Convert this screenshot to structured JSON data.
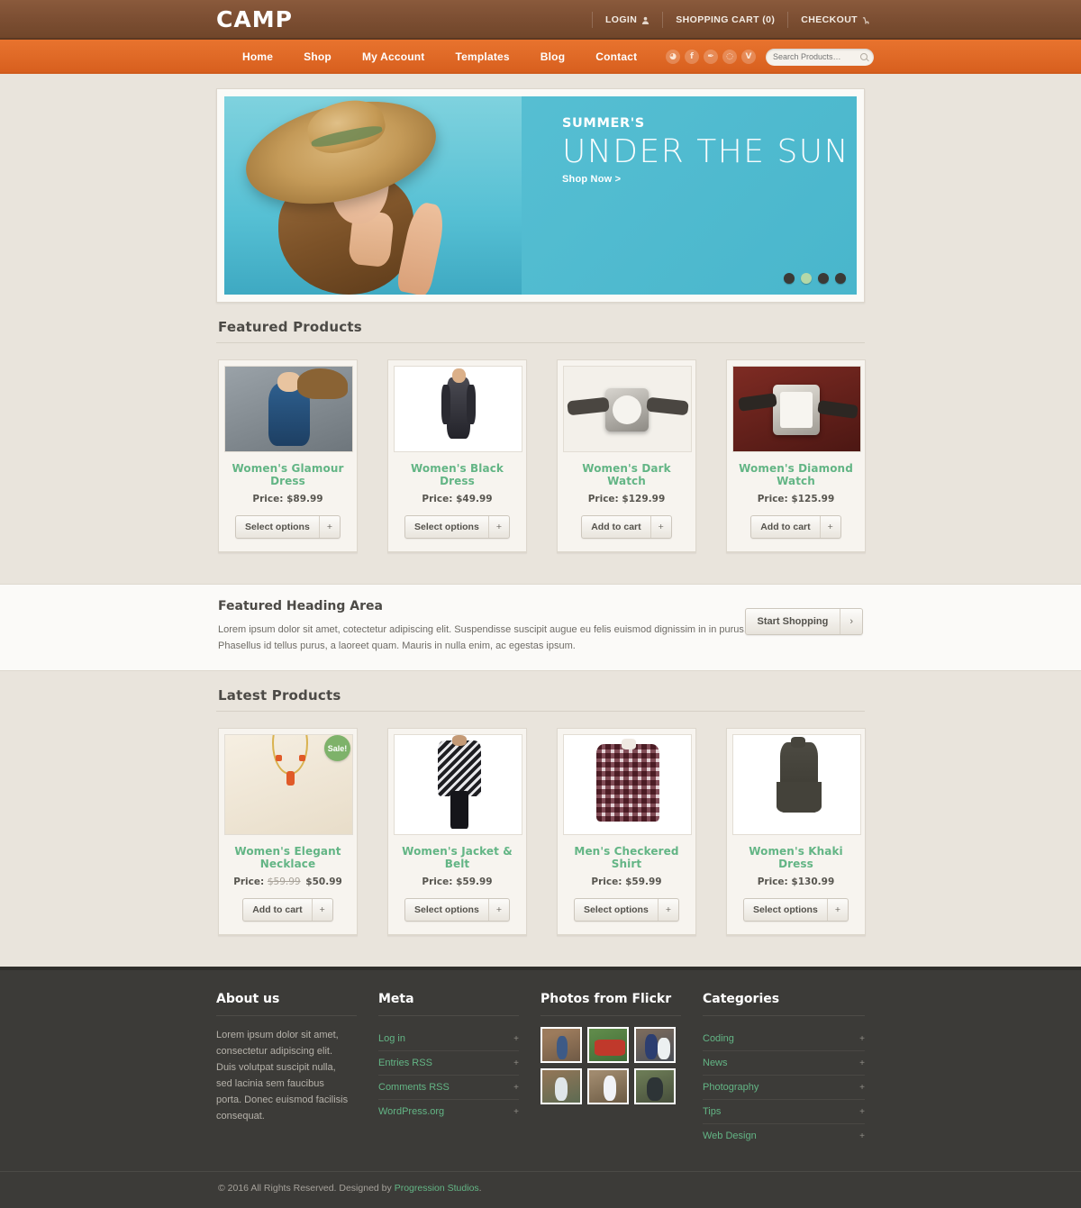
{
  "header": {
    "logo": "CAMP",
    "top_links": [
      {
        "label": "LOGIN",
        "icon": "user-icon"
      },
      {
        "label": "SHOPPING CART (0)",
        "icon": "none"
      },
      {
        "label": "CHECKOUT",
        "icon": "cart-icon"
      }
    ]
  },
  "nav": {
    "items": [
      {
        "label": "Home",
        "active": true
      },
      {
        "label": "Shop",
        "active": false
      },
      {
        "label": "My Account",
        "active": false
      },
      {
        "label": "Templates",
        "active": false
      },
      {
        "label": "Blog",
        "active": false
      },
      {
        "label": "Contact",
        "active": false
      }
    ],
    "social": [
      {
        "name": "rss-icon",
        "glyph": "◕"
      },
      {
        "name": "facebook-icon",
        "glyph": "f"
      },
      {
        "name": "twitter-icon",
        "glyph": "✒"
      },
      {
        "name": "dribbble-icon",
        "glyph": "◌"
      },
      {
        "name": "vimeo-icon",
        "glyph": "V"
      }
    ],
    "search": {
      "placeholder": "Search Products…",
      "value": ""
    }
  },
  "slider": {
    "subtitle": "SUMMER'S",
    "title": "UNDER THE SUN",
    "cta": "Shop Now >",
    "dots": 4,
    "active_dot": 2,
    "bg_color": "#50bbcf"
  },
  "featured": {
    "heading": "Featured Products",
    "products": [
      {
        "name": "Women's Glamour Dress",
        "price_label": "Price:",
        "price": "$89.99",
        "old_price": "",
        "button": "Select options",
        "plus": "+",
        "sale": false,
        "art": "grey"
      },
      {
        "name": "Women's Black Dress",
        "price_label": "Price:",
        "price": "$49.99",
        "old_price": "",
        "button": "Select options",
        "plus": "+",
        "sale": false,
        "art": "white"
      },
      {
        "name": "Women's Dark Watch",
        "price_label": "Price:",
        "price": "$129.99",
        "old_price": "",
        "button": "Add to cart",
        "plus": "+",
        "sale": false,
        "art": "dark"
      },
      {
        "name": "Women's Diamond Watch",
        "price_label": "Price:",
        "price": "$125.99",
        "old_price": "",
        "button": "Add to cart",
        "plus": "+",
        "sale": false,
        "art": "red"
      }
    ]
  },
  "feature_strip": {
    "title": "Featured Heading Area",
    "text": "Lorem ipsum dolor sit amet, cotectetur adipiscing elit. Suspendisse suscipit augue eu felis euismod dignissim in in purus. Phasellus id tellus purus, a laoreet quam. Mauris in nulla enim, ac egestas ipsum.",
    "button": "Start Shopping",
    "button_arrow": "›"
  },
  "latest": {
    "heading": "Latest Products",
    "products": [
      {
        "name": "Women's Elegant Necklace",
        "price_label": "Price:",
        "price": "$50.99",
        "old_price": "$59.99",
        "button": "Add to cart",
        "plus": "+",
        "sale": true,
        "sale_label": "Sale!",
        "art": "necklace"
      },
      {
        "name": "Women's Jacket & Belt",
        "price_label": "Price:",
        "price": "$59.99",
        "old_price": "",
        "button": "Select options",
        "plus": "+",
        "sale": false,
        "art": "jacket"
      },
      {
        "name": "Men's Checkered Shirt",
        "price_label": "Price:",
        "price": "$59.99",
        "old_price": "",
        "button": "Select options",
        "plus": "+",
        "sale": false,
        "art": "shirt"
      },
      {
        "name": "Women's Khaki Dress",
        "price_label": "Price:",
        "price": "$130.99",
        "old_price": "",
        "button": "Select options",
        "plus": "+",
        "sale": false,
        "art": "khaki"
      }
    ]
  },
  "footer": {
    "about": {
      "heading": "About us",
      "text": "Lorem ipsum dolor sit amet, consectetur adipiscing elit. Duis volutpat suscipit nulla, sed lacinia sem faucibus porta. Donec euismod facilisis consequat."
    },
    "meta": {
      "heading": "Meta",
      "links": [
        "Log in",
        "Entries RSS",
        "Comments RSS",
        "WordPress.org"
      ]
    },
    "flickr": {
      "heading": "Photos from Flickr",
      "count": 6
    },
    "categories": {
      "heading": "Categories",
      "links": [
        "Coding",
        "News",
        "Photography",
        "Tips",
        "Web Design"
      ]
    },
    "copyright_prefix": "© 2016 All Rights Reserved. Designed by ",
    "copyright_link": "Progression Studios",
    "copyright_suffix": "."
  },
  "colors": {
    "brand_orange": "#e06a27",
    "brand_brown": "#7d4f33",
    "green": "#63b585",
    "footer_dark": "#3c3b38"
  }
}
